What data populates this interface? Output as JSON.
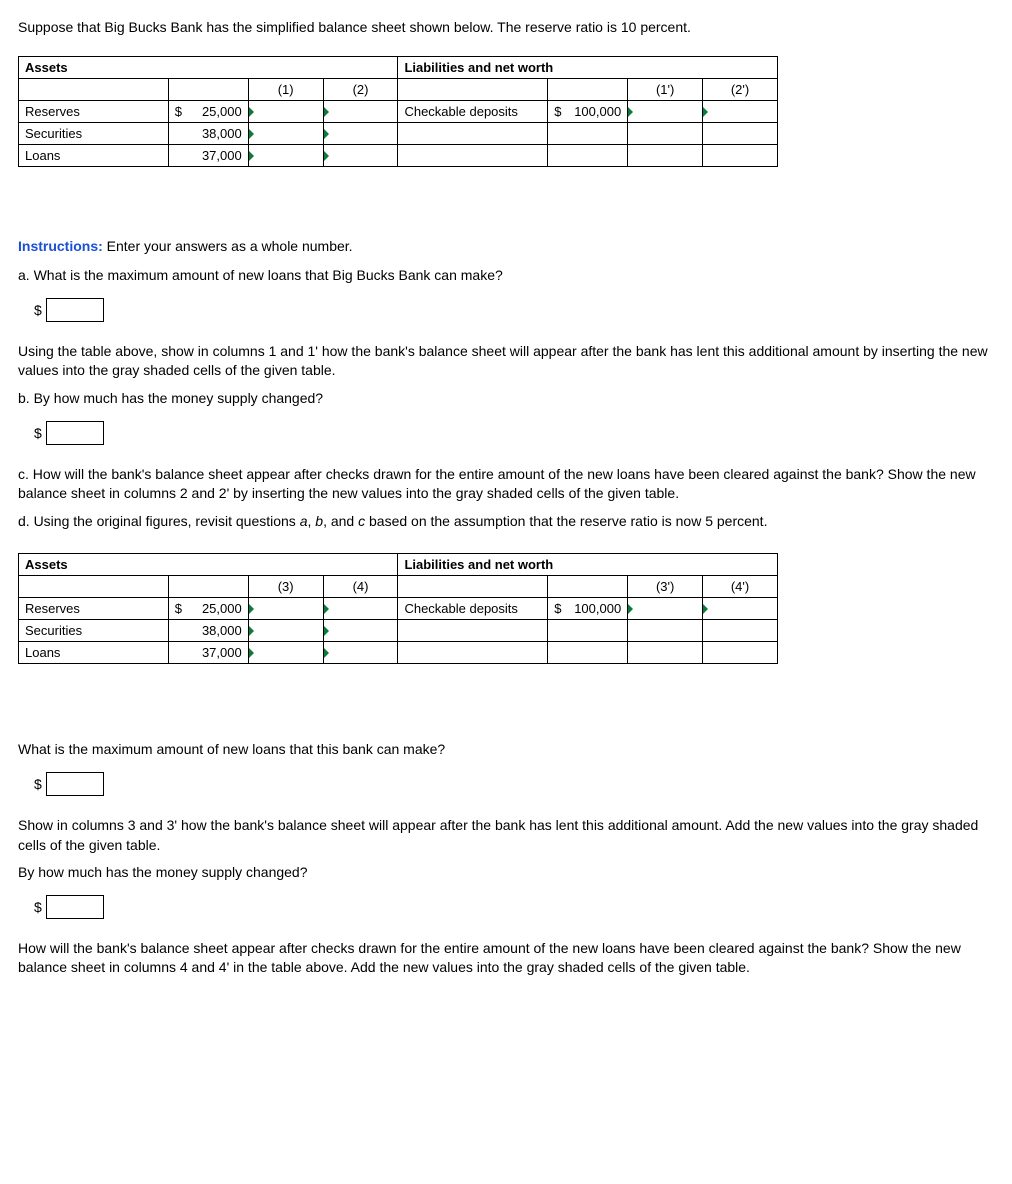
{
  "intro": "Suppose that Big Bucks Bank has the simplified balance sheet shown below. The reserve ratio is 10 percent.",
  "table1": {
    "assets_hdr": "Assets",
    "liab_hdr": "Liabilities and net worth",
    "col1": "(1)",
    "col2": "(2)",
    "col1p": "(1')",
    "col2p": "(2')",
    "rows": [
      {
        "label": "Reserves",
        "dollar": "$",
        "value": "25,000"
      },
      {
        "label": "Securities",
        "dollar": "",
        "value": "38,000"
      },
      {
        "label": "Loans",
        "dollar": "",
        "value": "37,000"
      }
    ],
    "liab_row": {
      "label": "Checkable deposits",
      "dollar": "$",
      "value": "100,000"
    }
  },
  "instructions_label": "Instructions:",
  "instructions_text": " Enter your answers as a whole number.",
  "qa": "a. What is the maximum amount of new loans that Big Bucks Bank can make?",
  "dollar": "$",
  "after_a": "Using the table above, show in columns 1 and 1' how the bank's balance sheet will appear after the bank has lent this additional amount by inserting the new values into the gray shaded cells of the given table.",
  "qb": "b. By how much has the money supply changed?",
  "qc": "c. How will the bank's balance sheet appear after checks drawn for the entire amount of the new loans have been cleared against the bank? Show the new balance sheet in columns 2 and 2' by inserting the new values into the gray shaded cells of the given table.",
  "qd_pre": "d. Using the original figures, revisit questions ",
  "qd_a": "a",
  "qd_sep1": ", ",
  "qd_b": "b",
  "qd_sep2": ", and ",
  "qd_c": "c",
  "qd_post": " based on the assumption that the reserve ratio is now 5 percent.",
  "table2": {
    "assets_hdr": "Assets",
    "liab_hdr": "Liabilities and net worth",
    "col1": "(3)",
    "col2": "(4)",
    "col1p": "(3')",
    "col2p": "(4')",
    "rows": [
      {
        "label": "Reserves",
        "dollar": "$",
        "value": "25,000"
      },
      {
        "label": "Securities",
        "dollar": "",
        "value": "38,000"
      },
      {
        "label": "Loans",
        "dollar": "",
        "value": "37,000"
      }
    ],
    "liab_row": {
      "label": "Checkable deposits",
      "dollar": "$",
      "value": "100,000"
    }
  },
  "q2a": "What is the maximum amount of new loans that this bank can make?",
  "after_2a": "Show in columns 3 and 3' how the bank's balance sheet will appear after the bank has lent this additional amount. Add the new values into the gray shaded cells of the given table.",
  "q2b": "By how much has the money supply changed?",
  "q2c": "How will the bank's balance sheet appear after checks drawn for the entire amount of the new loans have been cleared against the bank? Show the new balance sheet in columns 4 and 4' in the table above. Add the new values into the gray shaded cells of the given table."
}
